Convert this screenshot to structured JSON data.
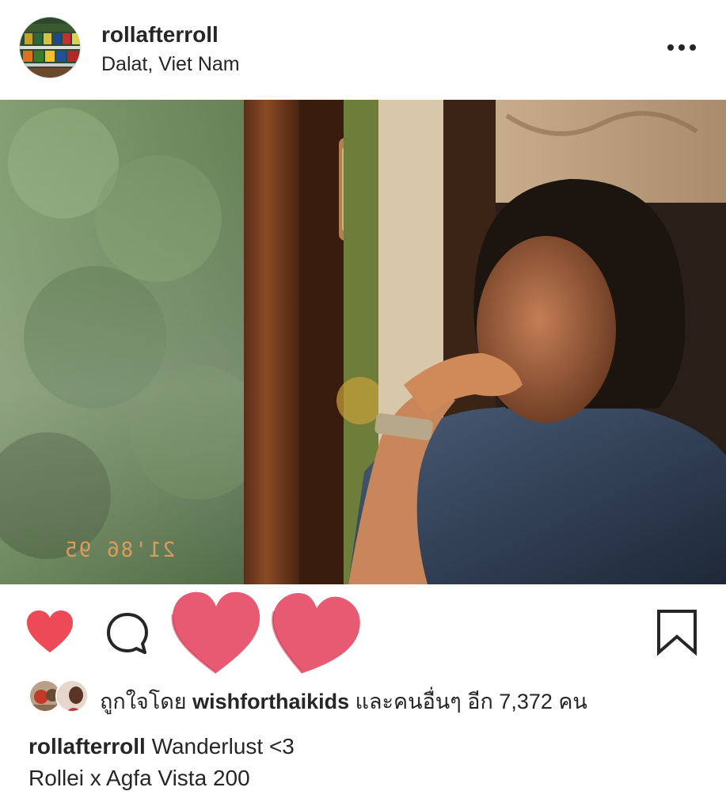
{
  "header": {
    "username": "rollafterroll",
    "location": "Dalat, Viet Nam",
    "avatar_icon": "profile-avatar",
    "more_icon": "more-horizontal-icon"
  },
  "photo": {
    "date_stamp": "21'86 95"
  },
  "actions": {
    "like_icon": "heart-filled-icon",
    "comment_icon": "comment-icon",
    "bookmark_icon": "bookmark-icon",
    "like_color": "#ed4956",
    "overlay_heart_color": "#e85a72"
  },
  "likes": {
    "prefix": "ถูกใจโดย ",
    "first_liker": "wishforthaikids",
    "suffix": " และคนอื่นๆ อีก 7,372 คน"
  },
  "caption": {
    "username": "rollafterroll",
    "text": " Wanderlust <3",
    "line2": "Rollei x Agfa Vista 200"
  }
}
